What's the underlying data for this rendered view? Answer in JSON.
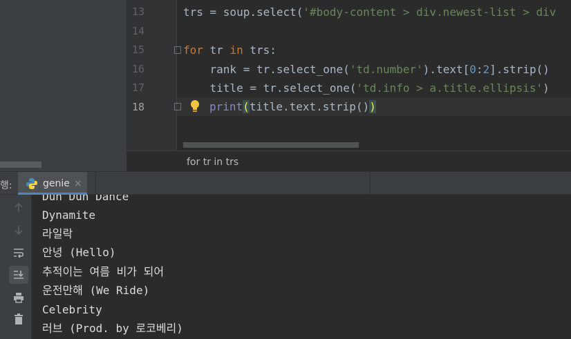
{
  "editor": {
    "line_numbers": [
      "13",
      "14",
      "15",
      "16",
      "17",
      "18"
    ],
    "lines": {
      "l13": {
        "a": "trs = soup.select(",
        "s": "'#body-content > div.newest-list > div"
      },
      "l15": {
        "kw1": "for",
        "mid": " tr ",
        "kw2": "in",
        "end": " trs:"
      },
      "l16": {
        "a": "    rank = tr.select_one(",
        "s": "'td.number'",
        "b": ").text[",
        "n1": "0",
        "c": ":",
        "n2": "2",
        "d": "].strip()"
      },
      "l17": {
        "a": "    title = tr.select_one(",
        "s": "'td.info > a.title.ellipsis'",
        "b": ")"
      },
      "l18": {
        "bi": "print",
        "open": "(",
        "mid": "title.text.strip()",
        "close": ")"
      }
    },
    "breadcrumb": "for tr in trs"
  },
  "run": {
    "label": "행:",
    "tab_name": "genie",
    "close_glyph": "×",
    "toolbar_icons": [
      "up-arrow-icon",
      "down-arrow-icon",
      "soft-wrap-icon",
      "scroll-to-end-icon",
      "print-icon",
      "trash-icon"
    ],
    "output_lines": [
      "Dun Dun Dance",
      "Dynamite",
      "라일락",
      "안녕 (Hello)",
      "추적이는 여름 비가 되어",
      "운전만해 (We Ride)",
      "Celebrity",
      "러브 (Prod. by 로코베리)"
    ]
  },
  "colors": {
    "keyword": "#cc7832",
    "string": "#6a8759",
    "number": "#6897bb",
    "builtin": "#8888c6",
    "tab_accent": "#4a88c7"
  }
}
